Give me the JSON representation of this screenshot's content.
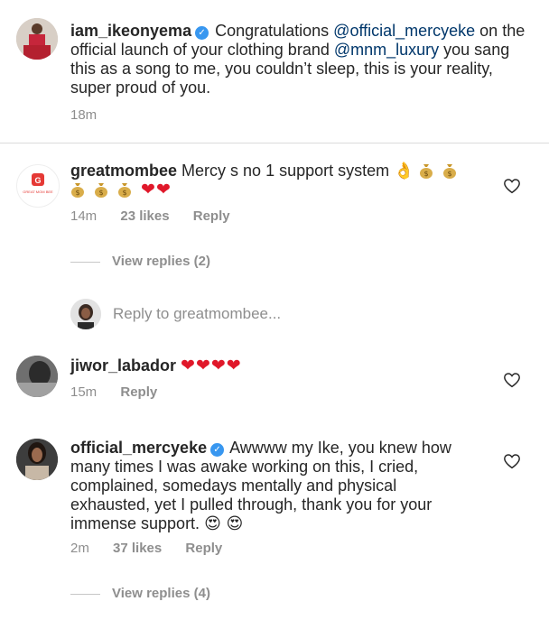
{
  "caption": {
    "username": "iam_ikeonyema",
    "text_before": " Congratulations ",
    "mention1": "@official_mercyeke",
    "text_mid": " on the  official launch of your clothing brand ",
    "mention2": "@mnm_luxury",
    "text_after": " you sang this as a song to me, you couldn’t sleep, this is your reality, super proud of you.",
    "time": "18m"
  },
  "comments": [
    {
      "username": "greatmombee",
      "text": " Mercy s no 1 support system",
      "emojis": "👌 💰 💰 💰 💰 💰 ❤️❤️",
      "time": "14m",
      "likes": "23 likes",
      "reply": "Reply",
      "view_replies": "View replies (2)"
    },
    {
      "username": "jiwor_labador",
      "hearts": "❤❤❤❤",
      "time": "15m",
      "reply": "Reply"
    },
    {
      "username": "official_mercyeke",
      "text": " Awwww my Ike, you knew how many times I was awake working on this, I cried, complained, somedays mentally and physical exhausted, yet I pulled through, thank you for your immense  support. ",
      "emojis": "😍 😍",
      "time": "2m",
      "likes": "37 likes",
      "reply": "Reply",
      "view_replies": "View replies (4)"
    }
  ],
  "reply_input": {
    "placeholder": "Reply to greatmombee..."
  },
  "avatars": {
    "greatmombee_logo_text": "GREAT MOM BEE"
  },
  "colors": {
    "verified": "#3897f0",
    "mention": "#00376b",
    "meta": "#8e8e8e",
    "heart_red": "#e0182a"
  }
}
